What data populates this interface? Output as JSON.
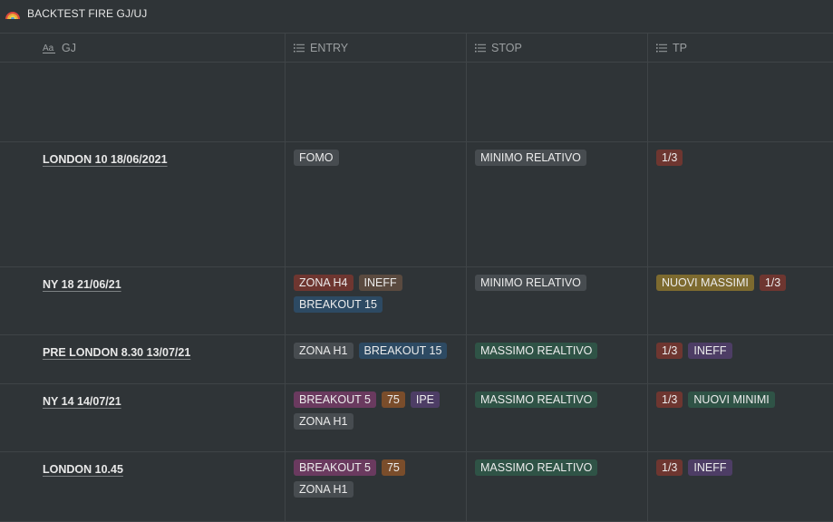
{
  "page": {
    "title": "BACKTEST FIRE GJ/UJ",
    "title_icon": "rainbow-icon"
  },
  "columns": [
    {
      "label": "GJ",
      "icon": "title-property-icon"
    },
    {
      "label": "ENTRY",
      "icon": "multi-select-icon"
    },
    {
      "label": "STOP",
      "icon": "multi-select-icon"
    },
    {
      "label": "TP",
      "icon": "multi-select-icon"
    }
  ],
  "colors": {
    "gray": "#474c50",
    "red": "#6e3630",
    "brown": "#5a4a3f",
    "blue": "#2d4a63",
    "yellow": "#7d6a2f",
    "green": "#2f5346",
    "purple": "#4d3d65",
    "pink": "#6a3a5f",
    "orange": "#7a4d2b"
  },
  "rows": [
    {
      "gj": "",
      "entry": [],
      "stop": [],
      "tp": []
    },
    {
      "gj": "LONDON 10 18/06/2021",
      "entry": [
        {
          "label": "FOMO",
          "color": "gray"
        }
      ],
      "stop": [
        {
          "label": "MINIMO RELATIVO",
          "color": "gray"
        }
      ],
      "tp": [
        {
          "label": "1/3",
          "color": "red"
        }
      ]
    },
    {
      "gj": "NY 18 21/06/21",
      "entry": [
        {
          "label": "ZONA H4",
          "color": "red"
        },
        {
          "label": "INEFF",
          "color": "brown"
        },
        {
          "label": "BREAKOUT 15",
          "color": "blue"
        }
      ],
      "stop": [
        {
          "label": "MINIMO RELATIVO",
          "color": "gray"
        }
      ],
      "tp": [
        {
          "label": "NUOVI MASSIMI",
          "color": "yellow"
        },
        {
          "label": "1/3",
          "color": "red"
        }
      ]
    },
    {
      "gj": "PRE LONDON 8.30 13/07/21",
      "entry": [
        {
          "label": "ZONA H1",
          "color": "gray"
        },
        {
          "label": "BREAKOUT 15",
          "color": "blue"
        }
      ],
      "stop": [
        {
          "label": "MASSIMO REALTIVO",
          "color": "green"
        }
      ],
      "tp": [
        {
          "label": "1/3",
          "color": "red"
        },
        {
          "label": "INEFF",
          "color": "purple"
        }
      ]
    },
    {
      "gj": "NY 14 14/07/21",
      "entry": [
        {
          "label": "BREAKOUT 5",
          "color": "pink"
        },
        {
          "label": "75",
          "color": "orange"
        },
        {
          "label": "IPE",
          "color": "purple"
        },
        {
          "label": "ZONA H1",
          "color": "gray"
        }
      ],
      "stop": [
        {
          "label": "MASSIMO REALTIVO",
          "color": "green"
        }
      ],
      "tp": [
        {
          "label": "1/3",
          "color": "red"
        },
        {
          "label": "NUOVI MINIMI",
          "color": "green"
        }
      ]
    },
    {
      "gj": "LONDON 10.45",
      "entry": [
        {
          "label": "BREAKOUT 5",
          "color": "pink"
        },
        {
          "label": "75",
          "color": "orange"
        },
        {
          "label": "ZONA H1",
          "color": "gray"
        }
      ],
      "stop": [
        {
          "label": "MASSIMO REALTIVO",
          "color": "green"
        }
      ],
      "tp": [
        {
          "label": "1/3",
          "color": "red"
        },
        {
          "label": "INEFF",
          "color": "purple"
        }
      ]
    }
  ]
}
